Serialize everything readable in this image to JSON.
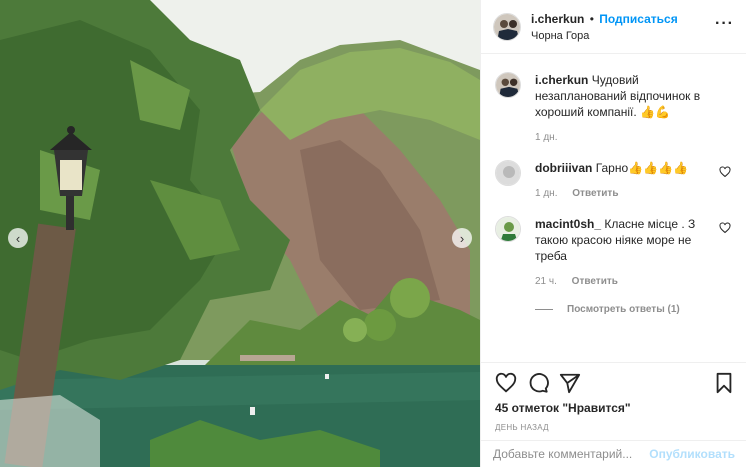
{
  "header": {
    "username": "i.cherkun",
    "separator": "•",
    "follow_label": "Подписаться",
    "location": "Чорна Гора",
    "more_icon": "more-horizontal-icon"
  },
  "media": {
    "prev_icon": "chevron-left-icon",
    "next_icon": "chevron-right-icon"
  },
  "caption": {
    "username": "i.cherkun",
    "text": "Чудовий незапланований відпочинок в хороший компанії. 👍💪",
    "time": "1 дн."
  },
  "comments": [
    {
      "username": "dobriiivan",
      "text": "Гарно👍👍👍👍",
      "time": "1 дн.",
      "reply_label": "Ответить"
    },
    {
      "username": "macint0sh_",
      "text": "Класне місце . З такою красою ніяке море не треба",
      "time": "21 ч.",
      "reply_label": "Ответить"
    }
  ],
  "replies": {
    "label": "Посмотреть ответы (1)"
  },
  "actions": {
    "icons": [
      "heart-icon",
      "comment-icon",
      "share-icon",
      "bookmark-icon"
    ],
    "likes_text": "45 отметок \"Нравится\"",
    "date": "ДЕНЬ НАЗАД"
  },
  "add_comment": {
    "placeholder": "Добавьте комментарий...",
    "publish_label": "Опубликовать"
  },
  "colors": {
    "accent": "#0095f6",
    "publish_disabled": "#b2dffc",
    "muted": "#8e8e8e"
  }
}
